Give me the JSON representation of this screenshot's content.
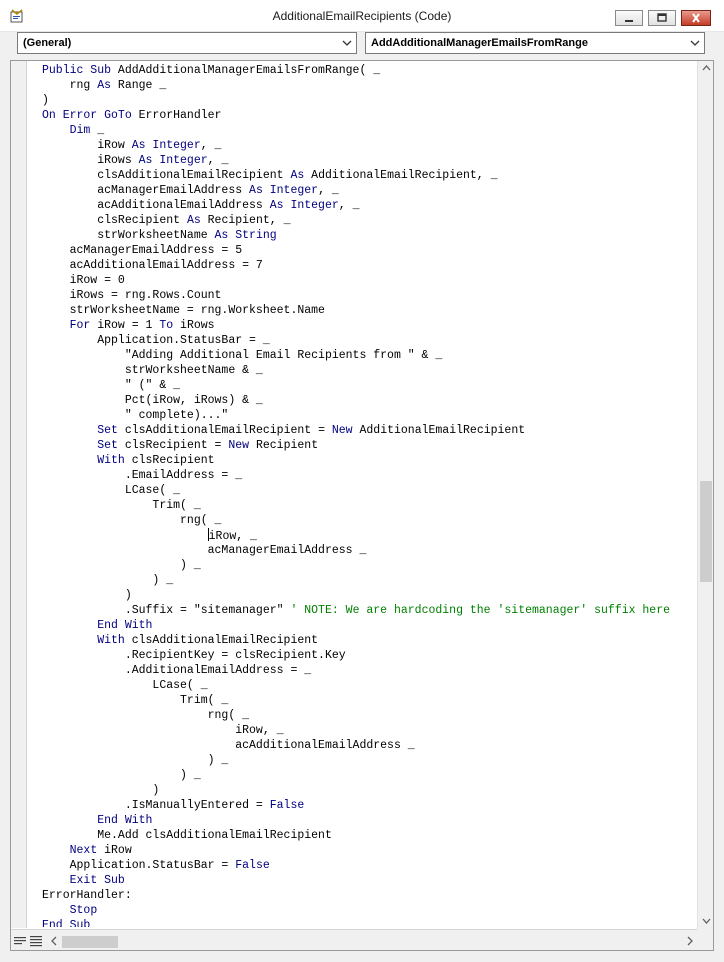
{
  "window": {
    "title": "AdditionalEmailRecipients (Code)"
  },
  "object_dropdown": {
    "selected": "(General)"
  },
  "procedure_dropdown": {
    "selected": "AddAdditionalManagerEmailsFromRange"
  },
  "colors": {
    "keyword": "#00007f",
    "comment": "#008000",
    "text": "#000000"
  },
  "code_lines": [
    [
      [
        "k",
        "Public Sub"
      ],
      [
        "t",
        " AddAdditionalManagerEmailsFromRange( _"
      ]
    ],
    [
      [
        "t",
        "    rng "
      ],
      [
        "k",
        "As"
      ],
      [
        "t",
        " Range _"
      ]
    ],
    [
      [
        "t",
        ")"
      ]
    ],
    [
      [
        "k",
        "On Error GoTo"
      ],
      [
        "t",
        " ErrorHandler"
      ]
    ],
    [
      [
        "t",
        "    "
      ],
      [
        "k",
        "Dim"
      ],
      [
        "t",
        " _"
      ]
    ],
    [
      [
        "t",
        "        iRow "
      ],
      [
        "k",
        "As Integer"
      ],
      [
        "t",
        ", _"
      ]
    ],
    [
      [
        "t",
        "        iRows "
      ],
      [
        "k",
        "As Integer"
      ],
      [
        "t",
        ", _"
      ]
    ],
    [
      [
        "t",
        "        clsAdditionalEmailRecipient "
      ],
      [
        "k",
        "As"
      ],
      [
        "t",
        " AdditionalEmailRecipient, _"
      ]
    ],
    [
      [
        "t",
        "        acManagerEmailAddress "
      ],
      [
        "k",
        "As Integer"
      ],
      [
        "t",
        ", _"
      ]
    ],
    [
      [
        "t",
        "        acAdditionalEmailAddress "
      ],
      [
        "k",
        "As Integer"
      ],
      [
        "t",
        ", _"
      ]
    ],
    [
      [
        "t",
        "        clsRecipient "
      ],
      [
        "k",
        "As"
      ],
      [
        "t",
        " Recipient, _"
      ]
    ],
    [
      [
        "t",
        "        strWorksheetName "
      ],
      [
        "k",
        "As String"
      ]
    ],
    [
      [
        "t",
        "    acManagerEmailAddress = 5"
      ]
    ],
    [
      [
        "t",
        "    acAdditionalEmailAddress = 7"
      ]
    ],
    [
      [
        "t",
        "    iRow = 0"
      ]
    ],
    [
      [
        "t",
        "    iRows = rng.Rows.Count"
      ]
    ],
    [
      [
        "t",
        "    strWorksheetName = rng.Worksheet.Name"
      ]
    ],
    [
      [
        "t",
        "    "
      ],
      [
        "k",
        "For"
      ],
      [
        "t",
        " iRow = 1 "
      ],
      [
        "k",
        "To"
      ],
      [
        "t",
        " iRows"
      ]
    ],
    [
      [
        "t",
        "        Application.StatusBar = _"
      ]
    ],
    [
      [
        "t",
        "            \"Adding Additional Email Recipients from \" & _"
      ]
    ],
    [
      [
        "t",
        "            strWorksheetName & _"
      ]
    ],
    [
      [
        "t",
        "            \" (\" & _"
      ]
    ],
    [
      [
        "t",
        "            Pct(iRow, iRows) & _"
      ]
    ],
    [
      [
        "t",
        "            \" complete)...\""
      ]
    ],
    [
      [
        "t",
        "        "
      ],
      [
        "k",
        "Set"
      ],
      [
        "t",
        " clsAdditionalEmailRecipient = "
      ],
      [
        "k",
        "New"
      ],
      [
        "t",
        " AdditionalEmailRecipient"
      ]
    ],
    [
      [
        "t",
        "        "
      ],
      [
        "k",
        "Set"
      ],
      [
        "t",
        " clsRecipient = "
      ],
      [
        "k",
        "New"
      ],
      [
        "t",
        " Recipient"
      ]
    ],
    [
      [
        "t",
        "        "
      ],
      [
        "k",
        "With"
      ],
      [
        "t",
        " clsRecipient"
      ]
    ],
    [
      [
        "t",
        "            .EmailAddress = _"
      ]
    ],
    [
      [
        "t",
        "            LCase( _"
      ]
    ],
    [
      [
        "t",
        "                Trim( _"
      ]
    ],
    [
      [
        "t",
        "                    rng( _"
      ]
    ],
    [
      [
        "t",
        "                        "
      ],
      [
        "c",
        ""
      ],
      [
        "t",
        "iRow, _"
      ]
    ],
    [
      [
        "t",
        "                        acManagerEmailAddress _"
      ]
    ],
    [
      [
        "t",
        "                    ) _"
      ]
    ],
    [
      [
        "t",
        "                ) _"
      ]
    ],
    [
      [
        "t",
        "            )"
      ]
    ],
    [
      [
        "t",
        "            .Suffix = \"sitemanager\" "
      ],
      [
        "m",
        "' NOTE: We are hardcoding the 'sitemanager' suffix here"
      ]
    ],
    [
      [
        "t",
        "        "
      ],
      [
        "k",
        "End With"
      ]
    ],
    [
      [
        "t",
        "        "
      ],
      [
        "k",
        "With"
      ],
      [
        "t",
        " clsAdditionalEmailRecipient"
      ]
    ],
    [
      [
        "t",
        "            .RecipientKey = clsRecipient.Key"
      ]
    ],
    [
      [
        "t",
        "            .AdditionalEmailAddress = _"
      ]
    ],
    [
      [
        "t",
        "                LCase( _"
      ]
    ],
    [
      [
        "t",
        "                    Trim( _"
      ]
    ],
    [
      [
        "t",
        "                        rng( _"
      ]
    ],
    [
      [
        "t",
        "                            iRow, _"
      ]
    ],
    [
      [
        "t",
        "                            acAdditionalEmailAddress _"
      ]
    ],
    [
      [
        "t",
        "                        ) _"
      ]
    ],
    [
      [
        "t",
        "                    ) _"
      ]
    ],
    [
      [
        "t",
        "                )"
      ]
    ],
    [
      [
        "t",
        "            .IsManuallyEntered = "
      ],
      [
        "k",
        "False"
      ]
    ],
    [
      [
        "t",
        "        "
      ],
      [
        "k",
        "End With"
      ]
    ],
    [
      [
        "t",
        "        Me.Add clsAdditionalEmailRecipient"
      ]
    ],
    [
      [
        "t",
        "    "
      ],
      [
        "k",
        "Next"
      ],
      [
        "t",
        " iRow"
      ]
    ],
    [
      [
        "t",
        "    Application.StatusBar = "
      ],
      [
        "k",
        "False"
      ]
    ],
    [
      [
        "t",
        "    "
      ],
      [
        "k",
        "Exit Sub"
      ]
    ],
    [
      [
        "t",
        "ErrorHandler:"
      ]
    ],
    [
      [
        "t",
        "    "
      ],
      [
        "k",
        "Stop"
      ]
    ],
    [
      [
        "k",
        "End Sub"
      ]
    ]
  ],
  "icons": {
    "app": "vba-code-window-icon",
    "minimize": "minimize-icon",
    "maximize": "maximize-icon",
    "close": "close-icon",
    "procedure_view": "procedure-view-icon",
    "full_module_view": "full-module-view-icon"
  }
}
